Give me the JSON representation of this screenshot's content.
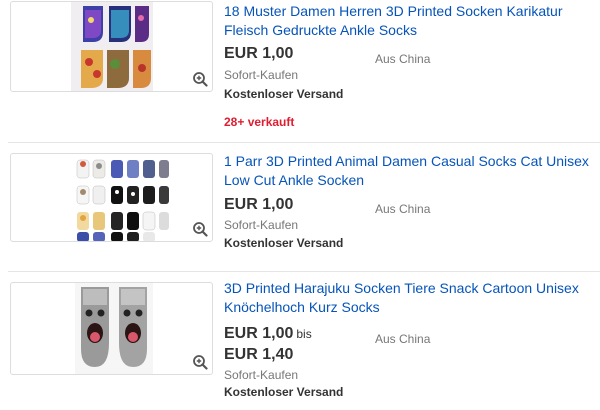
{
  "listings": [
    {
      "title": "18 Muster Damen Herren 3D Printed Socken Karikatur Fleisch Gedruckte Ankle Socks",
      "price": "EUR 1,00",
      "location": "Aus China",
      "format": "Sofort-Kaufen",
      "shipping": "Kostenloser Versand",
      "sold": "28+ verkauft",
      "zoom_icon": "zoom-icon"
    },
    {
      "title": "1 Parr 3D Printed Animal Damen Casual Socks Cat Unisex Low Cut Ankle Socken",
      "price": "EUR 1,00",
      "location": "Aus China",
      "format": "Sofort-Kaufen",
      "shipping": "Kostenloser Versand",
      "zoom_icon": "zoom-icon"
    },
    {
      "title": "3D Printed Harajuku Socken Tiere Snack Cartoon Unisex Knöchelhoch Kurz Socks",
      "price": "EUR 1,00",
      "price_range_word": "bis",
      "price_max": "EUR 1,40",
      "location": "Aus China",
      "format": "Sofort-Kaufen",
      "shipping": "Kostenloser Versand",
      "zoom_icon": "zoom-icon"
    }
  ],
  "colors": {
    "link": "#0654ba",
    "sold": "#dd1e31",
    "muted": "#777777"
  }
}
